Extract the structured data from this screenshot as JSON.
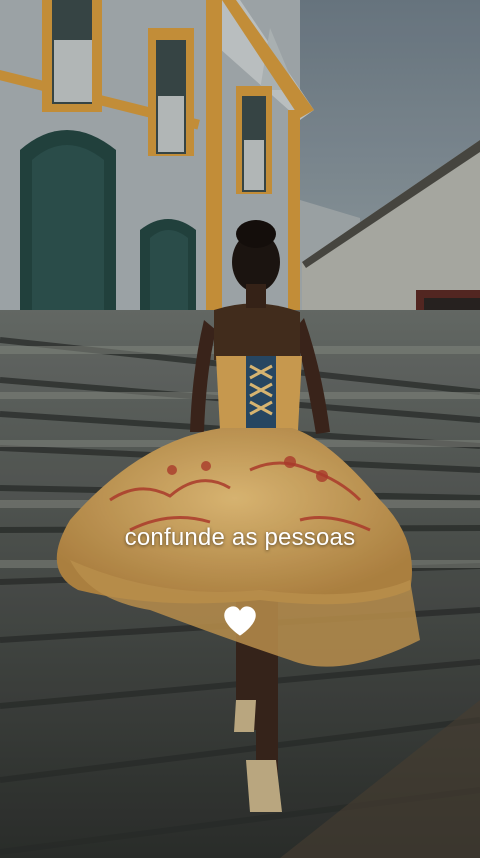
{
  "caption": {
    "text": "confunde as pessoas"
  },
  "heart": {
    "icon": "white-heart-icon",
    "color": "#ffffff"
  },
  "palette": {
    "sky": "#7e8c96",
    "wall": "#aab2b5",
    "trim": "#d39a3d",
    "door": "#2c4a47",
    "stairs": "#5f6662",
    "dress": "#d9a95a"
  }
}
